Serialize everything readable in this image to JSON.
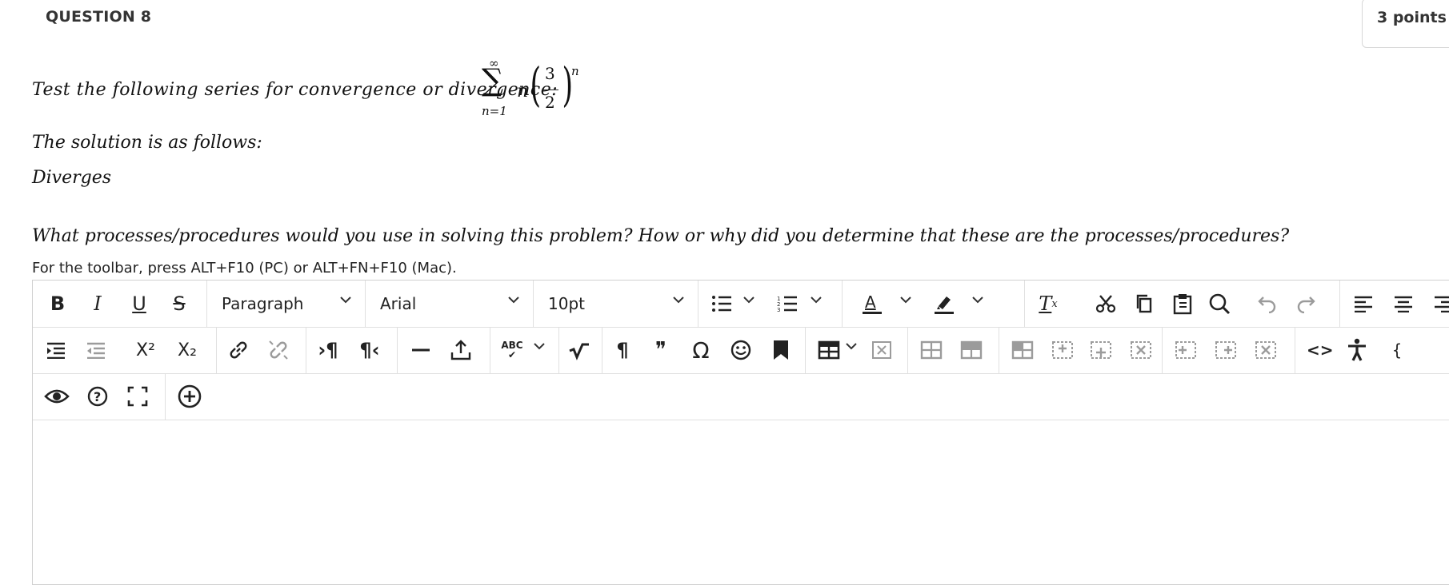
{
  "question": {
    "title": "QUESTION 8",
    "points": "3 points"
  },
  "prompt": {
    "intro": "Test the following series for convergence or divergence:",
    "series": {
      "sigma": "∑",
      "upper": "∞",
      "lower": "n=1",
      "term": "n",
      "numerator": "3",
      "denominator": "2",
      "exponent": "n"
    },
    "solution_intro": "The solution is as follows:",
    "solution": "Diverges",
    "question_text": "What processes/procedures would you use in solving this problem? How or why did you determine that these are the processes/procedures?"
  },
  "editor": {
    "toolbar_hint": "For the toolbar, press ALT+F10 (PC) or ALT+FN+F10 (Mac).",
    "format_select": "Paragraph",
    "font_select": "Arial",
    "size_select": "10pt",
    "glyphs": {
      "bold": "B",
      "italic": "I",
      "underline": "U",
      "strike": "S",
      "superscript": "X²",
      "subscript": "X₂",
      "pilcrow_ltr": "›¶",
      "pilcrow_rtl": "¶‹",
      "spellcheck": "ABC",
      "pilcrow": "¶",
      "quote": "❞",
      "omega": "Ω",
      "code": "<>",
      "clear_format": "T",
      "clear_format_sub": "x",
      "text_color": "A"
    },
    "accent": "#222222",
    "disabled_color": "#9b9b9b"
  }
}
